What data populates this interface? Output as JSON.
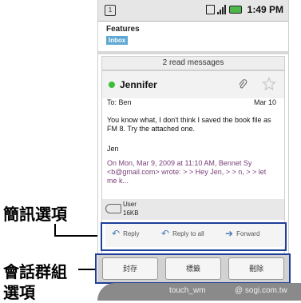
{
  "statusbar": {
    "time": "1:49 PM",
    "notify_glyph": "1"
  },
  "header": {
    "title": "Features",
    "badge": "Inbox"
  },
  "thread": {
    "read_messages": "2 read messages"
  },
  "message": {
    "sender": "Jennifer",
    "to": "To: Ben",
    "date": "Mar 10",
    "body": "You know what, I don't think I saved the book file as FM 8.  Try the attached one.",
    "signature": "Jen",
    "quote": "On Mon, Mar 9, 2009 at 11:10 AM, Bennet Sy <b@gmail.com> wrote: > > Hey Jen, >  > n, >  > let me k...",
    "attachment": {
      "name": "User",
      "size": "16KB"
    }
  },
  "actions": {
    "reply": "Reply",
    "reply_all": "Reply to all",
    "forward": "Forward"
  },
  "bottom_buttons": {
    "archive": "封存",
    "labels": "標籤",
    "delete": "刪除"
  },
  "annotations": {
    "message_options": "簡訊選項",
    "conversation_options_line1": "會話群組",
    "conversation_options_line2": "選項"
  },
  "watermark": {
    "left": "touch_wm",
    "right": "@ sogi.com.tw"
  },
  "colors": {
    "presence": "#3bbf3b",
    "badge": "#5fa8d3",
    "highlight_outline": "#1e3f9a",
    "quote": "#7a3f7a"
  }
}
